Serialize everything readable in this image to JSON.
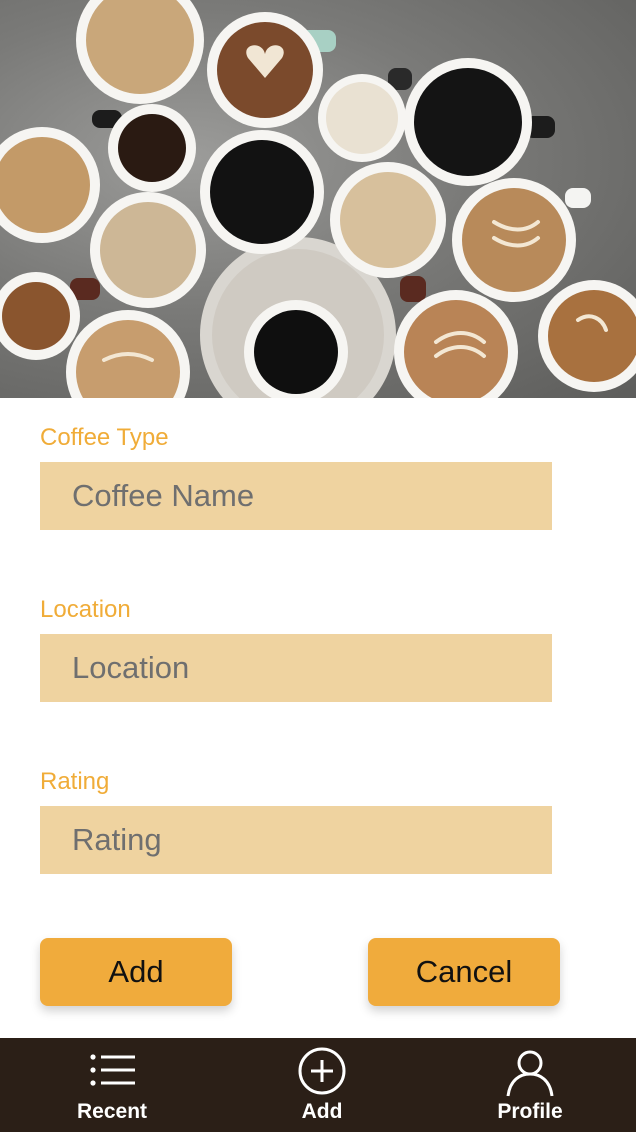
{
  "hero": {
    "icon": "coffee-cups-photo"
  },
  "form": {
    "coffee_type": {
      "label": "Coffee Type",
      "placeholder": "Coffee Name",
      "value": ""
    },
    "location": {
      "label": "Location",
      "placeholder": "Location",
      "value": ""
    },
    "rating": {
      "label": "Rating",
      "placeholder": "Rating",
      "value": ""
    }
  },
  "actions": {
    "add_label": "Add",
    "cancel_label": "Cancel"
  },
  "nav": {
    "items": [
      {
        "label": "Recent",
        "icon": "list-icon"
      },
      {
        "label": "Add",
        "icon": "add-circle-icon"
      },
      {
        "label": "Profile",
        "icon": "person-icon"
      }
    ]
  },
  "colors": {
    "accent": "#f0ac38",
    "input_bg": "#efd3a0",
    "button_bg": "#f0ab3c",
    "nav_bg": "#2b1f17"
  }
}
